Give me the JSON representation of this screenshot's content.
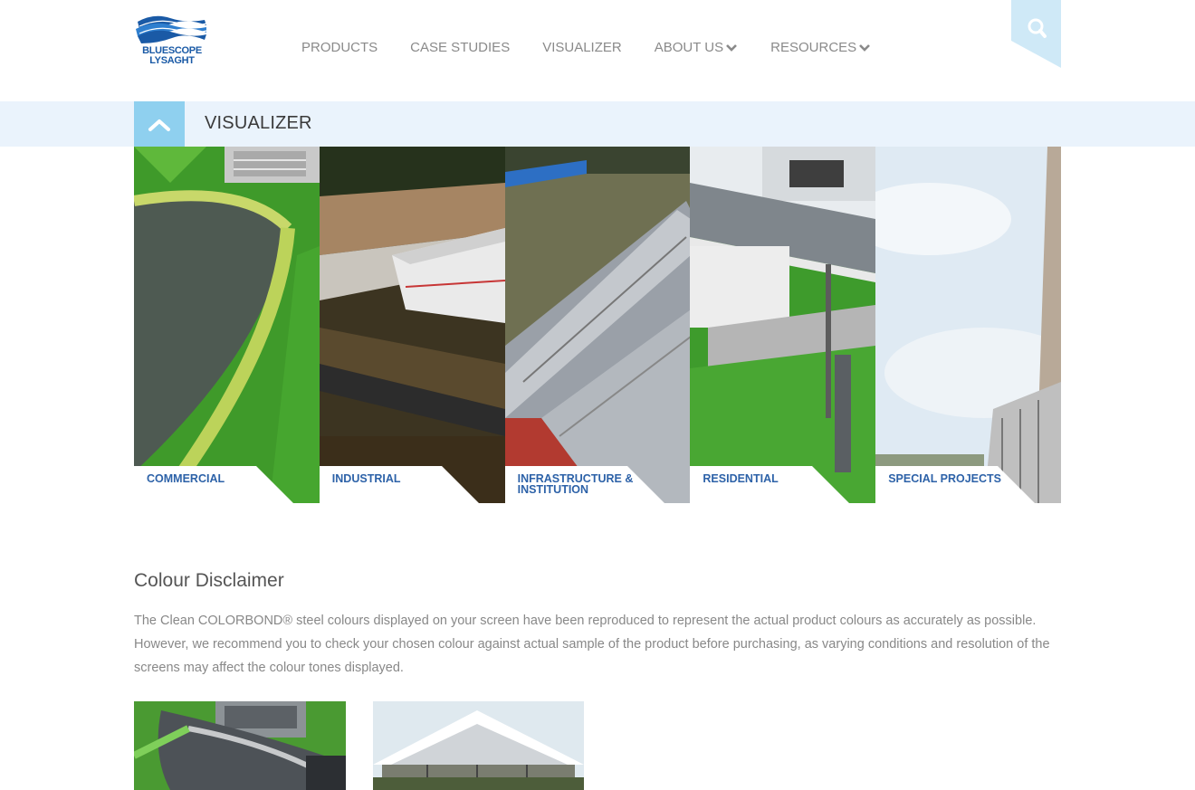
{
  "brand": {
    "name_line1": "BLUESCOPE",
    "name_line2": "LYSAGHT",
    "color": "#1a5aa6"
  },
  "nav": {
    "items": [
      {
        "label": "PRODUCTS",
        "has_dropdown": false
      },
      {
        "label": "CASE STUDIES",
        "has_dropdown": false
      },
      {
        "label": "VISUALIZER",
        "has_dropdown": false
      },
      {
        "label": "ABOUT US",
        "has_dropdown": true
      },
      {
        "label": "RESOURCES",
        "has_dropdown": true
      }
    ],
    "search_icon": "search-icon"
  },
  "page": {
    "title": "VISUALIZER",
    "accent": "#8fd0ef",
    "bar_color": "#eaf3fc"
  },
  "categories": [
    {
      "label": "COMMERCIAL"
    },
    {
      "label": "INDUSTRIAL"
    },
    {
      "label": "INFRASTRUCTURE & INSTITUTION"
    },
    {
      "label": "RESIDENTIAL"
    },
    {
      "label": "SPECIAL PROJECTS"
    }
  ],
  "disclaimer": {
    "title": "Colour Disclaimer",
    "body": "The Clean COLORBOND® steel colours displayed on your screen have been reproduced to represent the actual product colours as accurately as possible. However, we recommend you to check your chosen colour against actual sample of the product before purchasing, as varying conditions and resolution of the screens may affect the colour tones displayed."
  },
  "label_color": "#2d62a8"
}
